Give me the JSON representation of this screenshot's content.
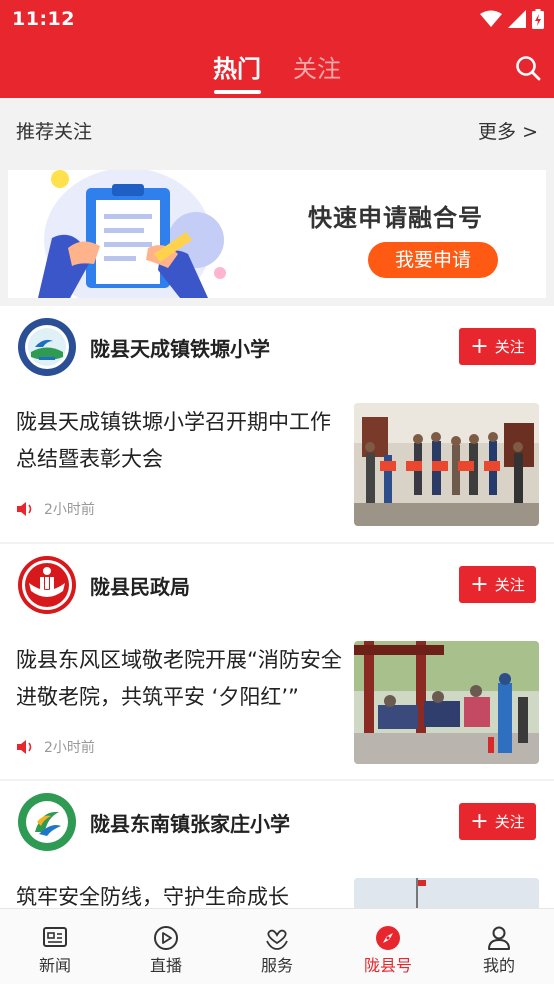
{
  "status_bar": {
    "time": "11:12"
  },
  "header": {
    "tabs": [
      {
        "label": "热门",
        "active": true
      },
      {
        "label": "关注",
        "active": false
      }
    ]
  },
  "recommend": {
    "title": "推荐关注",
    "more_label": "更多 >"
  },
  "banner": {
    "headline": "快速申请融合号",
    "button_label": "我要申请"
  },
  "follow_label": "关注",
  "cards": [
    {
      "account_name": "陇县天成镇铁塬小学",
      "headline": "陇县天成镇铁塬小学召开期中工作总结暨表彰大会",
      "time": "2小时前"
    },
    {
      "account_name": "陇县民政局",
      "headline": "陇县东风区域敬老院开展“消防安全进敬老院，共筑平安 ‘夕阳红’”",
      "time": "2小时前"
    },
    {
      "account_name": "陇县东南镇张家庄小学",
      "headline": "筑牢安全防线，守护生命成长",
      "time": ""
    }
  ],
  "bottom_nav": [
    {
      "label": "新闻",
      "icon": "news-icon",
      "active": false
    },
    {
      "label": "直播",
      "icon": "play-icon",
      "active": false
    },
    {
      "label": "服务",
      "icon": "service-icon",
      "active": false
    },
    {
      "label": "陇县号",
      "icon": "compass-icon",
      "active": true
    },
    {
      "label": "我的",
      "icon": "user-icon",
      "active": false
    }
  ],
  "colors": {
    "brand": "#e8262d",
    "apply_button": "#ff5a14",
    "muted_text": "#999999"
  }
}
